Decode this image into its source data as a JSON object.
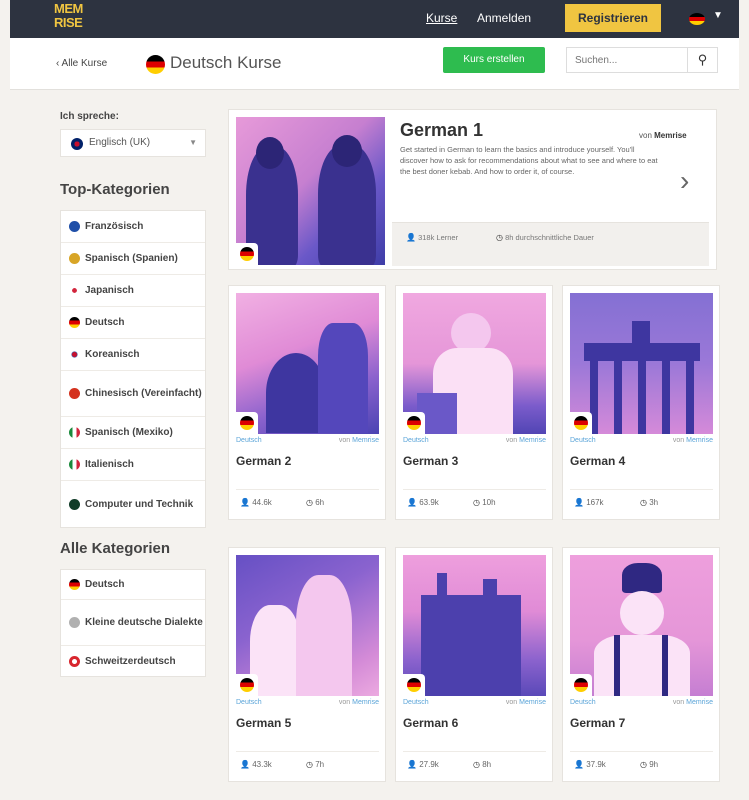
{
  "nav": {
    "logo": "MEM RISE",
    "kurse": "Kurse",
    "anmelden": "Anmelden",
    "registrieren": "Registrieren"
  },
  "subheader": {
    "back": "‹ Alle Kurse",
    "title": "Deutsch Kurse",
    "create": "Kurs erstellen",
    "search_placeholder": "Suchen..."
  },
  "sidebar": {
    "speak_label": "Ich spreche:",
    "speak_value": "Englisch (UK)",
    "top_heading": "Top-Kategorien",
    "top_items": [
      {
        "label": "Französisch",
        "color": "#1f4fa8"
      },
      {
        "label": "Spanisch (Spanien)",
        "color": "#d8a526"
      },
      {
        "label": "Japanisch",
        "color": "#d2253c"
      },
      {
        "label": "Deutsch",
        "color": "#c2141b"
      },
      {
        "label": "Koreanisch",
        "color": "#2d3a8c"
      },
      {
        "label": "Chinesisch (Vereinfacht)",
        "color": "#d4321e"
      },
      {
        "label": "Spanisch (Mexiko)",
        "color": "#1b8a3c"
      },
      {
        "label": "Italienisch",
        "color": "#1b8a3c"
      },
      {
        "label": "Computer und Technik",
        "color": "#113c28"
      }
    ],
    "all_heading": "Alle Kategorien",
    "all_items": [
      {
        "label": "Deutsch",
        "color": "#c2141b"
      },
      {
        "label": "Kleine deutsche Dialekte",
        "color": "#b0b0b0"
      },
      {
        "label": "Schweitzerdeutsch",
        "color": "#d8262e"
      }
    ]
  },
  "featured": {
    "title": "German 1",
    "by_prefix": "von",
    "by_author": "Memrise",
    "description": "Get started in German to learn the basics and introduce yourself. You'll discover how to ask for recommendations about what to see and where to eat the best doner kebab. And how to order it, of course.",
    "learners": "318k Lerner",
    "duration": "8h durchschnittliche Dauer"
  },
  "courses": [
    {
      "category": "Deutsch",
      "by_prefix": "von",
      "by_author": "Memrise",
      "title": "German 2",
      "learners": "44.6k",
      "duration": "6h"
    },
    {
      "category": "Deutsch",
      "by_prefix": "von",
      "by_author": "Memrise",
      "title": "German 3",
      "learners": "63.9k",
      "duration": "10h"
    },
    {
      "category": "Deutsch",
      "by_prefix": "von",
      "by_author": "Memrise",
      "title": "German 4",
      "learners": "167k",
      "duration": "3h"
    },
    {
      "category": "Deutsch",
      "by_prefix": "von",
      "by_author": "Memrise",
      "title": "German 5",
      "learners": "43.3k",
      "duration": "7h"
    },
    {
      "category": "Deutsch",
      "by_prefix": "von",
      "by_author": "Memrise",
      "title": "German 6",
      "learners": "27.9k",
      "duration": "8h"
    },
    {
      "category": "Deutsch",
      "by_prefix": "von",
      "by_author": "Memrise",
      "title": "German 7",
      "learners": "37.9k",
      "duration": "9h"
    }
  ]
}
